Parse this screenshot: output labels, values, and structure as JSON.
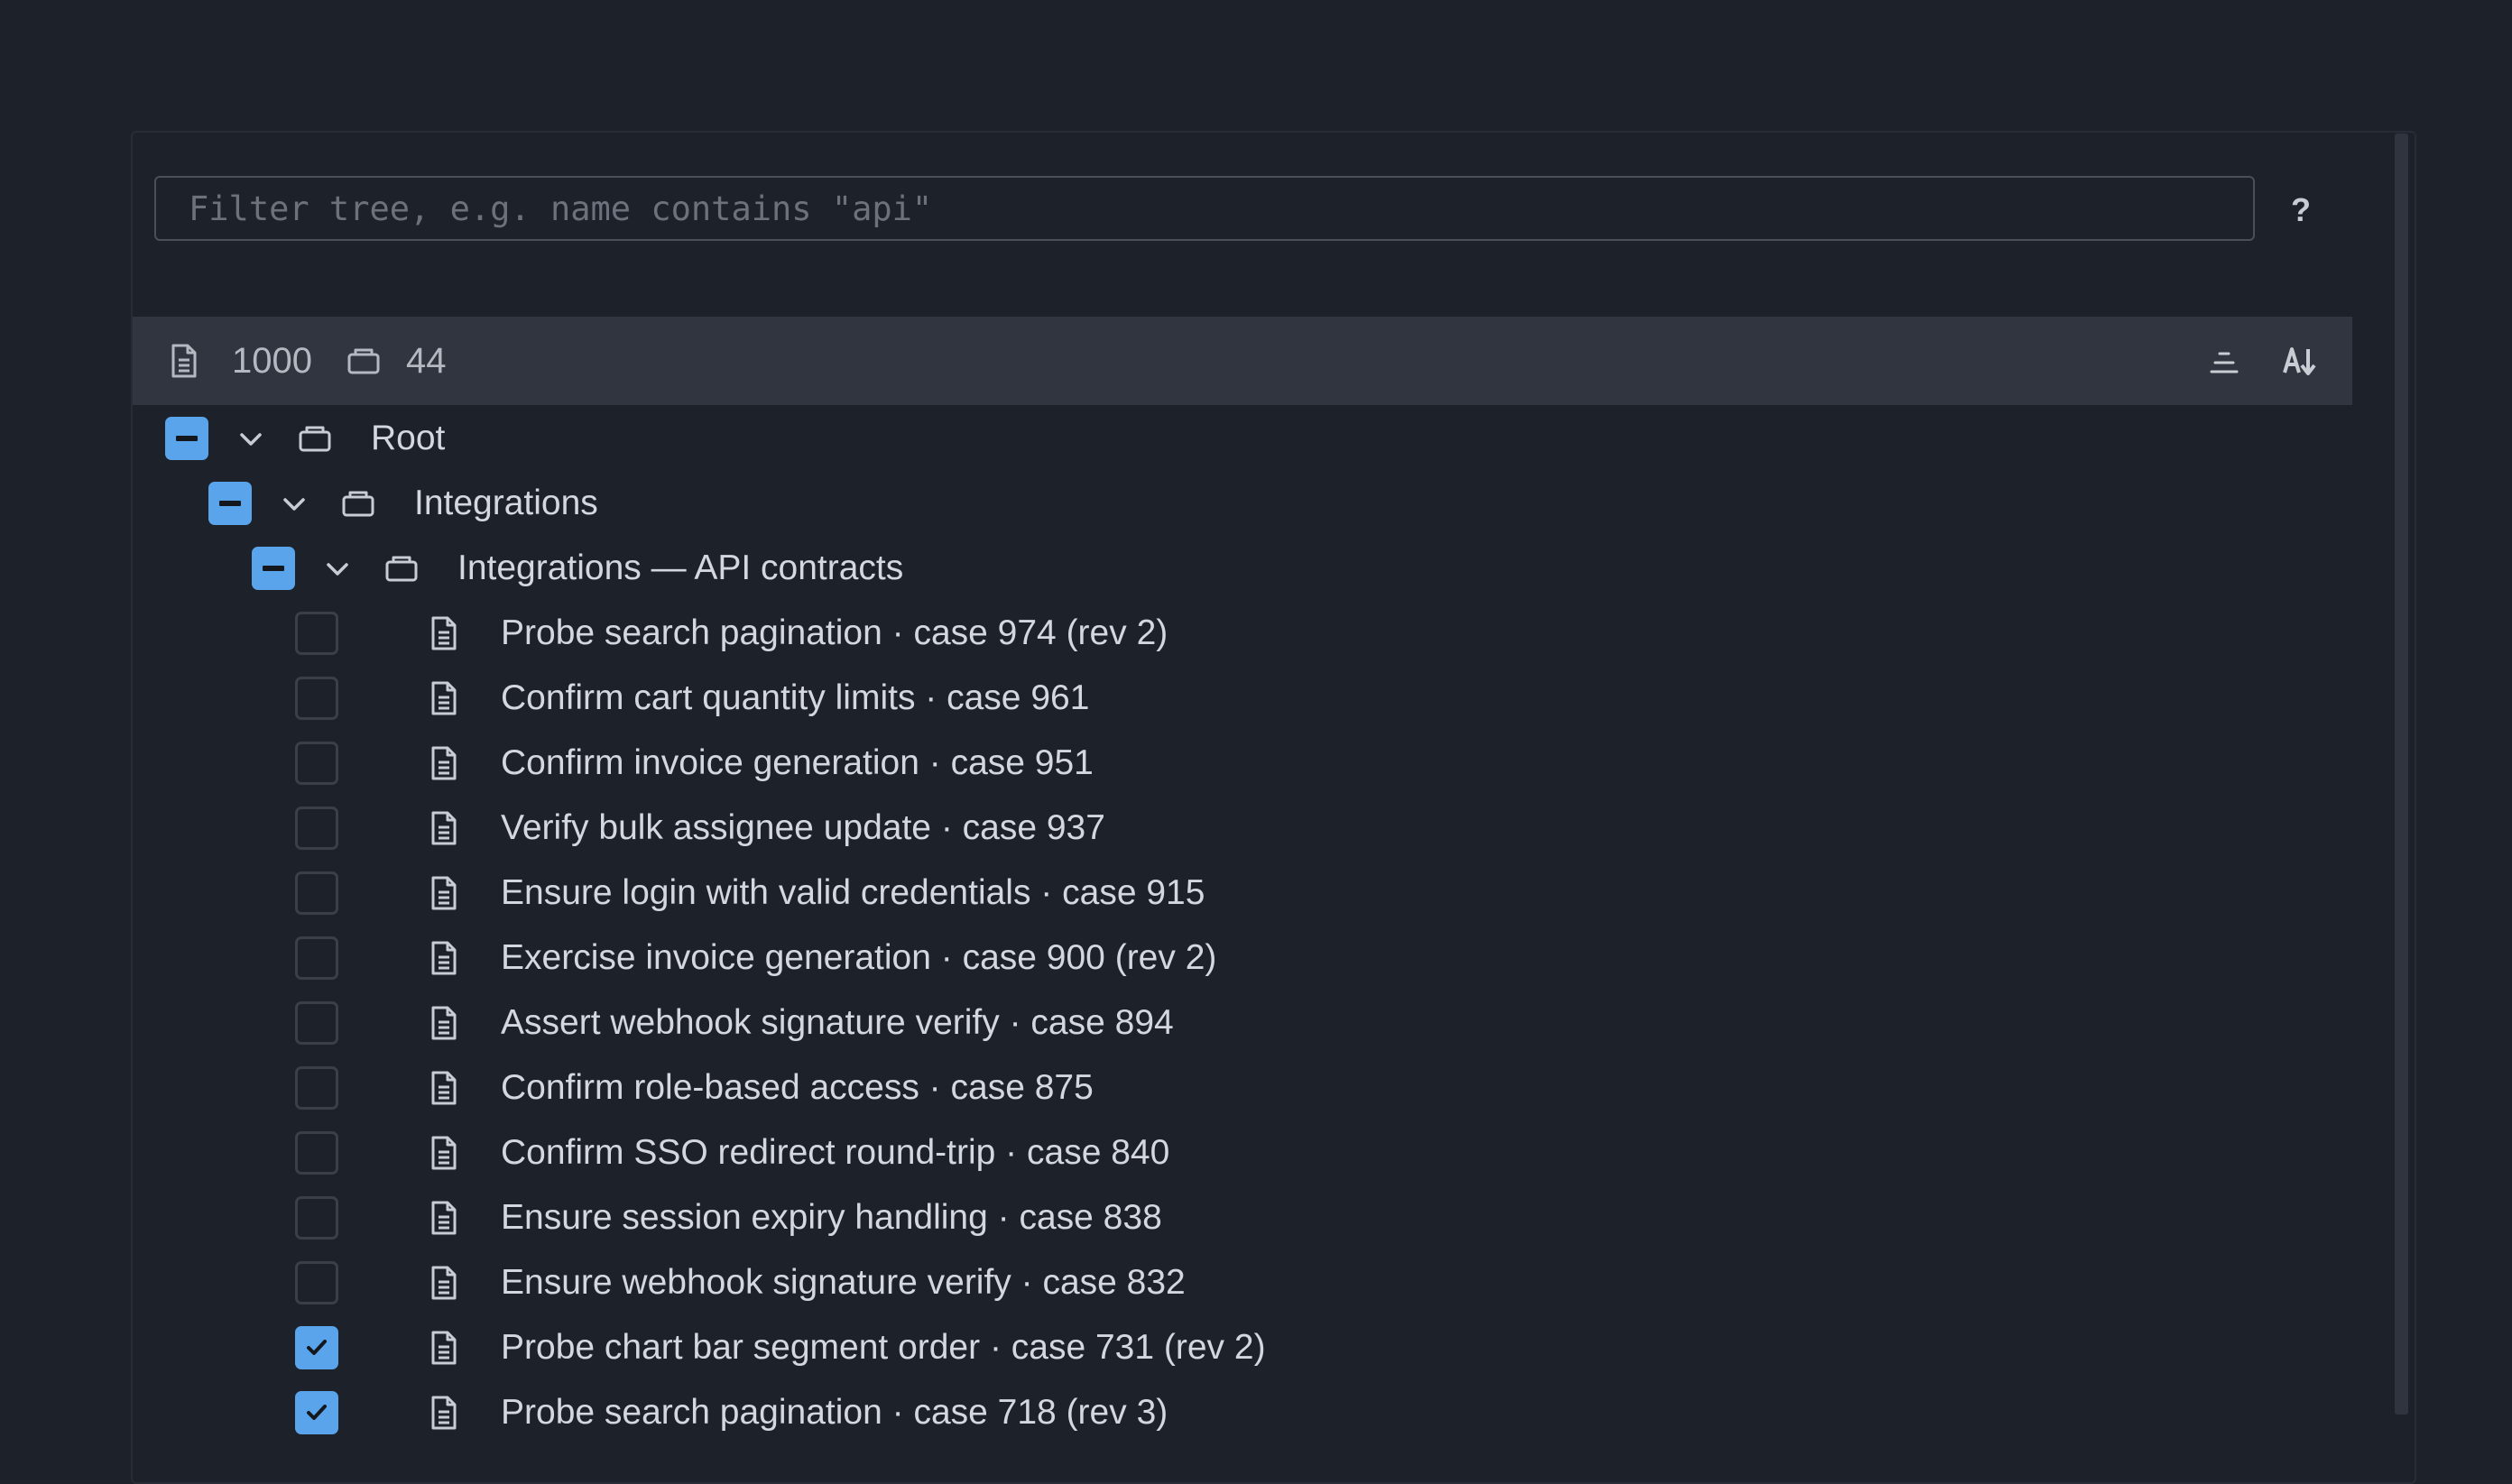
{
  "filter": {
    "placeholder": "Filter tree, e.g. name contains \"api\"",
    "value": ""
  },
  "help_label": "?",
  "stats": {
    "files_count": "1000",
    "folders_count": "44"
  },
  "toolbar": {
    "icons": [
      "collapse-all-icon",
      "sort-alpha-icon"
    ]
  },
  "tree": {
    "root": {
      "label": "Root",
      "state": "mixed",
      "expanded": true
    },
    "integrations": {
      "label": "Integrations",
      "state": "mixed",
      "expanded": true
    },
    "api_contracts": {
      "label": "Integrations — API contracts",
      "state": "mixed",
      "expanded": true
    },
    "items": [
      {
        "label": "Probe search pagination · case 974 (rev 2)",
        "checked": false
      },
      {
        "label": "Confirm cart quantity limits · case 961",
        "checked": false
      },
      {
        "label": "Confirm invoice generation · case 951",
        "checked": false
      },
      {
        "label": "Verify bulk assignee update · case 937",
        "checked": false
      },
      {
        "label": "Ensure login with valid credentials · case 915",
        "checked": false
      },
      {
        "label": "Exercise invoice generation · case 900 (rev 2)",
        "checked": false
      },
      {
        "label": "Assert webhook signature verify · case 894",
        "checked": false
      },
      {
        "label": "Confirm role-based access · case 875",
        "checked": false
      },
      {
        "label": "Confirm SSO redirect round-trip · case 840",
        "checked": false
      },
      {
        "label": "Ensure session expiry handling · case 838",
        "checked": false
      },
      {
        "label": "Ensure webhook signature verify · case 832",
        "checked": false
      },
      {
        "label": "Probe chart bar segment order · case 731 (rev 2)",
        "checked": true
      },
      {
        "label": "Probe search pagination · case 718 (rev 3)",
        "checked": true
      }
    ]
  },
  "colors": {
    "background": "#1d212a",
    "stats_bar": "#30353f",
    "accent": "#5aa4ec",
    "text": "#d4d7dd",
    "muted_text": "#b4b8c0"
  }
}
